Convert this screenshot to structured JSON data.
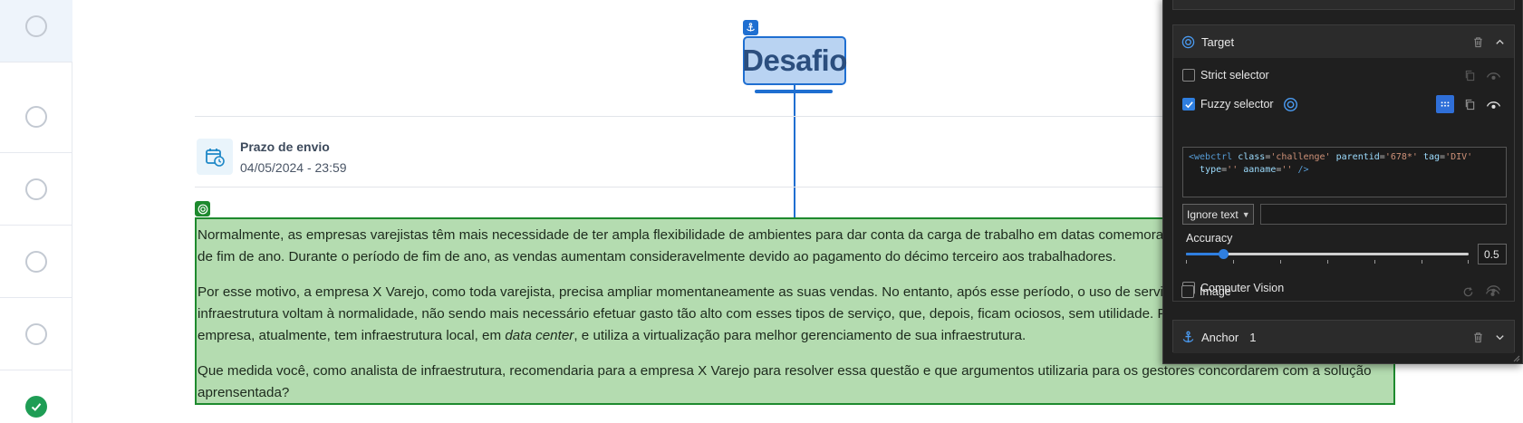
{
  "rail": {
    "steps": [
      {
        "status": "pending",
        "active": true
      },
      {
        "status": "pending",
        "active": false
      },
      {
        "status": "pending",
        "active": false
      },
      {
        "status": "pending",
        "active": false
      },
      {
        "status": "pending",
        "active": false
      },
      {
        "status": "completed",
        "active": false
      }
    ]
  },
  "page": {
    "title": "Desafio",
    "deadline_label": "Prazo de envio",
    "deadline_value": "04/05/2024 - 23:59",
    "paragraph1": "Normalmente, as empresas varejistas têm mais necessidade de ter ampla flexibilidade de ambientes para dar conta da carga de trabalho em datas comemorativas, como no caso do período",
    "paragraph1b": "de fim de ano. Durante o período de fim de ano, as vendas aumentam consideravelmente devido ao pagamento do décimo terceiro aos trabalhadores.",
    "paragraph2a": "Por esse motivo, a empresa X Varejo, como toda varejista, precisa ampliar momentaneamente as suas vendas. No entanto, após esse período, o uso de servidores e de recursos de",
    "paragraph2b": "infraestrutura voltam à normalidade, não sendo mais necessário efetuar gasto tão alto com esses tipos de serviço, que, depois, ficam ociosos, sem utilidade. Para agravar ainda mais, a",
    "paragraph2c_pre": "empresa, atualmente, tem infraestrutura local, em ",
    "paragraph2c_em": "data center",
    "paragraph2c_post": ", e utiliza a virtualização para melhor gerenciamento de sua infraestrutura.",
    "paragraph3a": "Que medida você, como analista de infraestrutura, recomendaria para a empresa X Varejo para resolver essa questão e que argumentos utilizaria para os gestores concordarem com a solução",
    "paragraph3b": "aprensentada?"
  },
  "inspector": {
    "target_section_title": "Target",
    "strict_selector_label": "Strict selector",
    "strict_selector_checked": false,
    "fuzzy_selector_label": "Fuzzy selector",
    "fuzzy_selector_checked": true,
    "selector_code": {
      "tag_open": "<webctrl",
      "a1": "class",
      "v1": "'challenge'",
      "a2": "parentid",
      "v2": "'678*'",
      "a3": "tag",
      "v3": "'DIV'",
      "a4": "type",
      "v4": "''",
      "a5": "aaname",
      "v5": "''",
      "close": "/>"
    },
    "ignore_text_label": "Ignore text",
    "ignore_text_value": "",
    "accuracy_label": "Accuracy",
    "accuracy_value": "0.5",
    "accuracy_fraction": 0.13,
    "computer_vision_label": "Computer Vision",
    "computer_vision_checked": false,
    "image_label": "Image",
    "image_checked": false,
    "anchor_section_title": "Anchor",
    "anchor_count": "1",
    "colors": {
      "accent": "#2f7fe0",
      "target_outline": "#1e8a2e",
      "anchor_outline": "#1f6fd1",
      "panel_bg": "#202020"
    }
  }
}
